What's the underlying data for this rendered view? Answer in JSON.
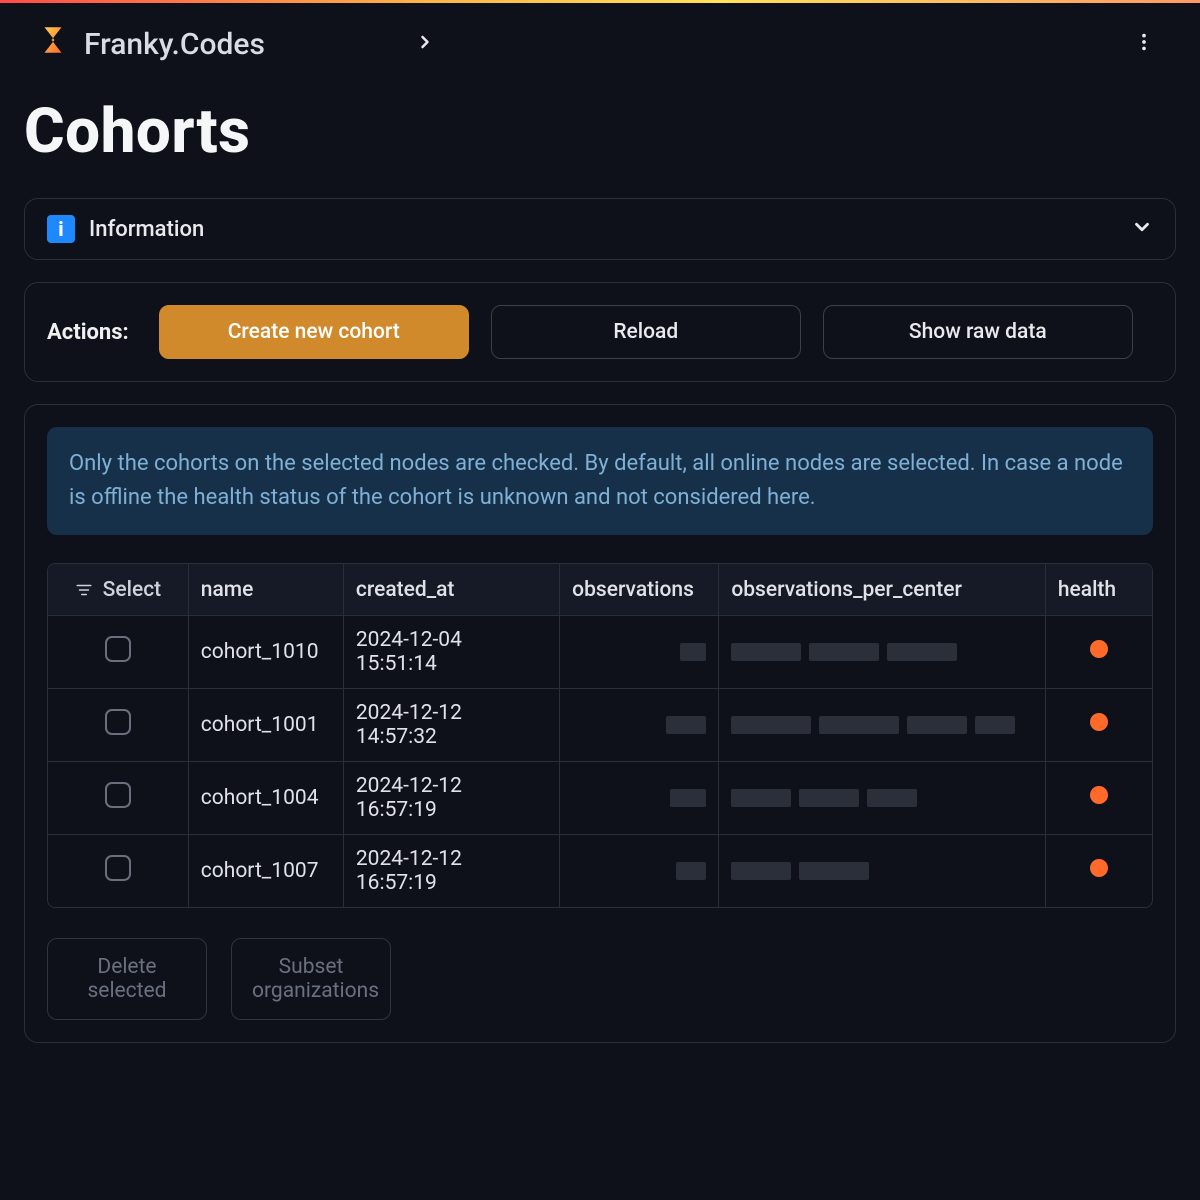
{
  "brand": {
    "name": "Franky.Codes"
  },
  "page": {
    "title": "Cohorts"
  },
  "info": {
    "label": "Information",
    "icon_letter": "i"
  },
  "actions": {
    "label": "Actions:",
    "create": "Create new cohort",
    "reload": "Reload",
    "show_raw": "Show raw data"
  },
  "notice": "Only the cohorts on the selected nodes are checked. By default, all online nodes are selected. In case a node is offline the health status of the cohort is unknown and not considered here.",
  "table": {
    "headers": {
      "select": "Select",
      "name": "name",
      "created_at": "created_at",
      "observations": "observations",
      "observations_per_center": "observations_per_center",
      "health": "health"
    },
    "rows": [
      {
        "name": "cohort_1010",
        "created_at": "2024-12-04 15:51:14",
        "observations": "(redacted)",
        "observations_per_center": "(redacted)",
        "health": "warning"
      },
      {
        "name": "cohort_1001",
        "created_at": "2024-12-12 14:57:32",
        "observations": "(redacted)",
        "observations_per_center": "(redacted)",
        "health": "warning"
      },
      {
        "name": "cohort_1004",
        "created_at": "2024-12-12 16:57:19",
        "observations": "(redacted)",
        "observations_per_center": "(redacted)",
        "health": "warning"
      },
      {
        "name": "cohort_1007",
        "created_at": "2024-12-12 16:57:19",
        "observations": "(redacted)",
        "observations_per_center": "(redacted)",
        "health": "warning"
      }
    ]
  },
  "footer": {
    "delete_selected": "Delete selected",
    "subset_orgs": "Subset organizations"
  },
  "colors": {
    "accent": "#d18a2b",
    "health_warning": "#ff6a2b",
    "notice_bg": "#163049",
    "notice_fg": "#7fb0d6"
  }
}
